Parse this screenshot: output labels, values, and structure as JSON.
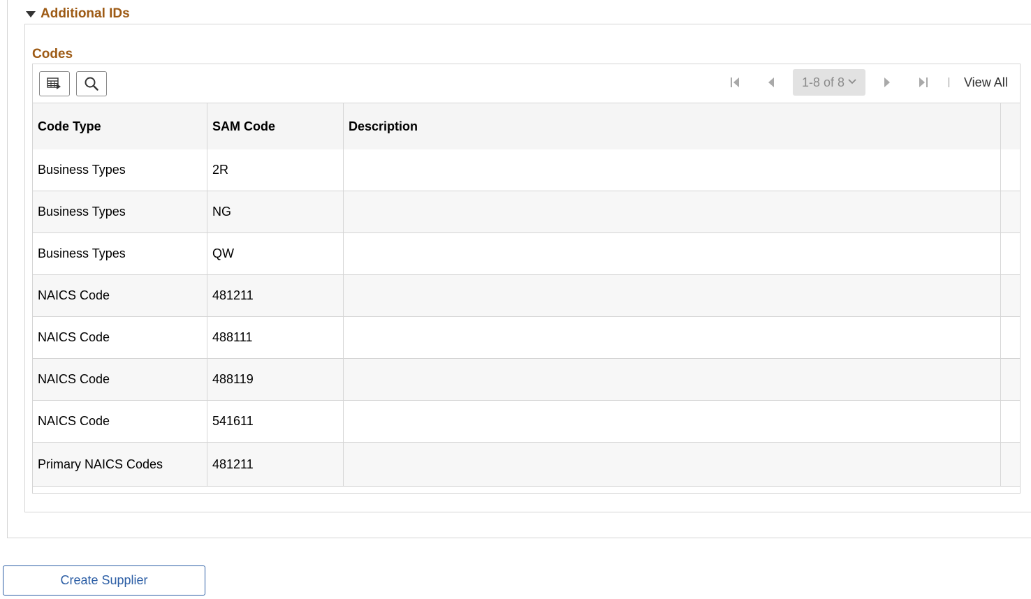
{
  "section": {
    "title": "Additional IDs"
  },
  "grid": {
    "title": "Codes",
    "pagination": {
      "range": "1-8 of 8",
      "view_all": "View All"
    },
    "columns": [
      "Code Type",
      "SAM Code",
      "Description"
    ],
    "rows": [
      [
        "Business Types",
        "2R",
        ""
      ],
      [
        "Business Types",
        "NG",
        ""
      ],
      [
        "Business Types",
        "QW",
        ""
      ],
      [
        "NAICS Code",
        "481211",
        ""
      ],
      [
        "NAICS Code",
        "488111",
        ""
      ],
      [
        "NAICS Code",
        "488119",
        ""
      ],
      [
        "NAICS Code",
        "541611",
        ""
      ],
      [
        "Primary NAICS Codes",
        "481211",
        ""
      ]
    ]
  },
  "actions": {
    "create_supplier": "Create Supplier"
  },
  "colors": {
    "section_title": "#9d5a14",
    "link_blue": "#2c5ea5",
    "border": "#d5d5d5"
  },
  "icons": [
    "collapse-triangle-icon",
    "personalize-grid-icon",
    "search-icon",
    "first-page-icon",
    "previous-page-icon",
    "chevron-down-icon",
    "next-page-icon",
    "last-page-icon"
  ]
}
